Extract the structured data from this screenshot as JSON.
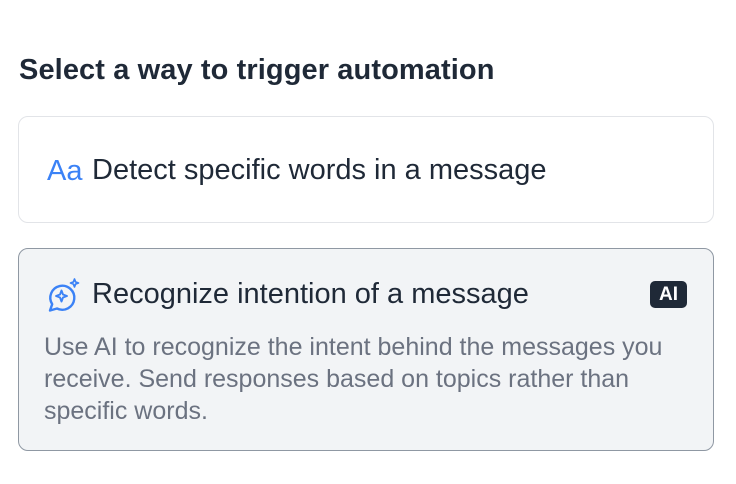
{
  "heading": "Select a way to trigger automation",
  "options": [
    {
      "icon": "text-aa-icon",
      "icon_glyph": "Aa",
      "label": "Detect specific words in a message",
      "selected": false
    },
    {
      "icon": "ai-chat-sparkle-icon",
      "label": "Recognize intention of a message",
      "badge": "AI",
      "description": "Use AI to recognize the intent behind the messages you receive. Send responses based on topics rather than specific words.",
      "selected": true
    }
  ],
  "colors": {
    "accent": "#3b82f6",
    "text": "#1f2937",
    "muted": "#6b7280",
    "selected_bg": "#f2f4f6",
    "selected_border": "#8f98a3",
    "badge_bg": "#1f2937"
  }
}
